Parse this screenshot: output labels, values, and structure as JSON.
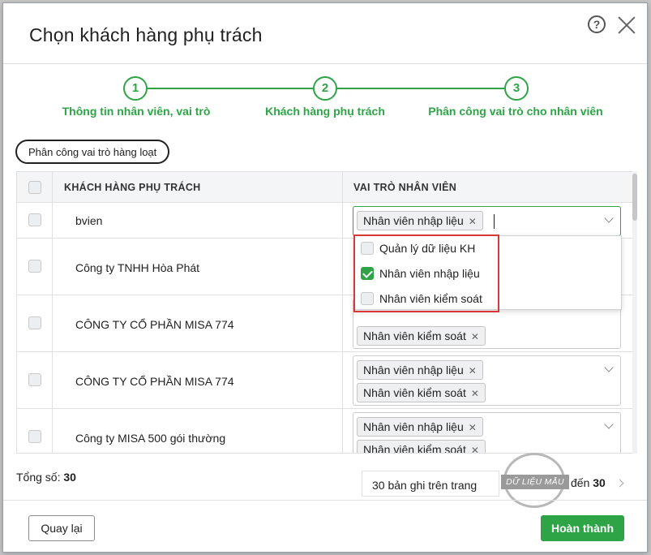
{
  "dialog": {
    "title": "Chọn khách hàng phụ trách",
    "help_glyph": "?"
  },
  "steps": [
    {
      "number": "1",
      "label": "Thông tin nhân viên, vai trò"
    },
    {
      "number": "2",
      "label": "Khách hàng phụ trách"
    },
    {
      "number": "3",
      "label": "Phân công vai trò cho nhân viên"
    }
  ],
  "toolbar": {
    "bulk_assign_label": "Phân công vai trò hàng loạt"
  },
  "table": {
    "columns": [
      "KHÁCH HÀNG PHỤ TRÁCH",
      "VAI TRÒ NHÂN VIÊN"
    ],
    "rows": [
      {
        "customer": "bvien",
        "roles": [
          "Nhân viên nhập liệu"
        ]
      },
      {
        "customer": "Công ty TNHH Hòa Phát",
        "roles": []
      },
      {
        "customer": "CÔNG TY CỔ PHẦN MISA 774",
        "roles": [
          "Nhân viên kiểm soát"
        ]
      },
      {
        "customer": "CÔNG TY CỔ PHẦN MISA 774",
        "roles": [
          "Nhân viên nhập liệu",
          "Nhân viên kiểm soát"
        ]
      },
      {
        "customer": "Công ty MISA 500 gói thường",
        "roles": [
          "Nhân viên nhập liệu",
          "Nhân viên kiểm soát"
        ]
      }
    ],
    "tag_remove_glyph": "✕"
  },
  "dropdown": {
    "options": [
      {
        "label": "Quản lý dữ liệu KH",
        "checked": false
      },
      {
        "label": "Nhân viên nhập liệu",
        "checked": true
      },
      {
        "label": "Nhân viên kiểm soát",
        "checked": false
      }
    ]
  },
  "footer": {
    "total_label": "Tổng số:",
    "total_value": "30",
    "page_size_label": "30 bản ghi trên trang",
    "to_label": "đến",
    "to_value": "30",
    "watermark": "DỮ LIỆU MẪU",
    "back_label": "Quay lại",
    "done_label": "Hoàn thành"
  },
  "colors": {
    "accent": "#2ea447",
    "highlight": "#d9383a"
  }
}
